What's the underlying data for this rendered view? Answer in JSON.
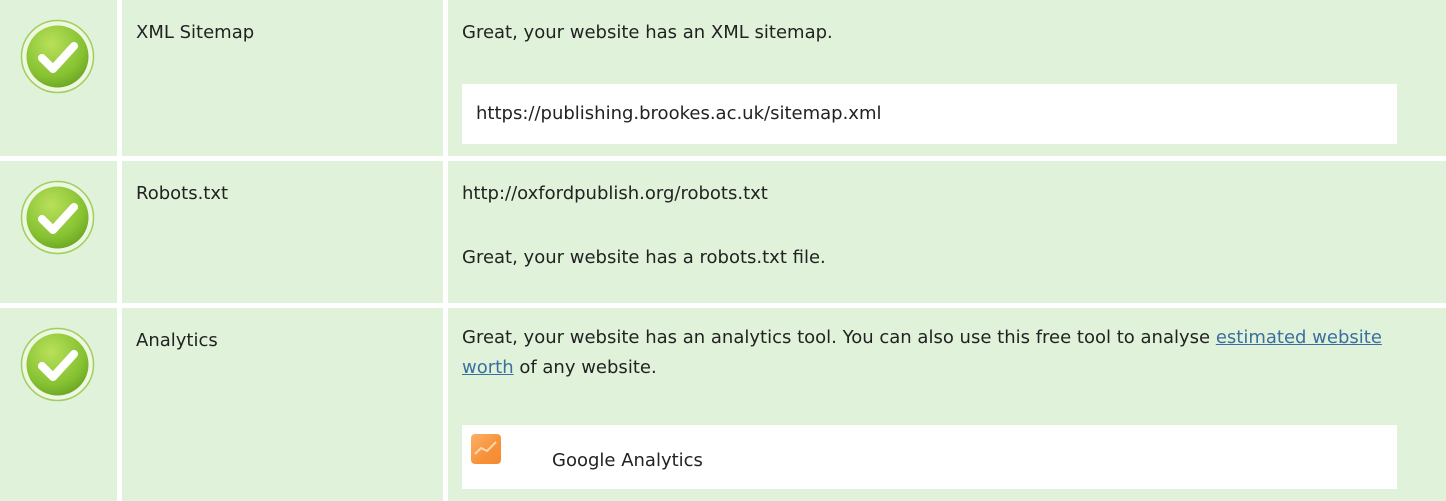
{
  "rows": [
    {
      "label": "XML Sitemap",
      "status": "pass",
      "message": "Great, your website has an XML sitemap.",
      "box": "https://publishing.brookes.ac.uk/sitemap.xml"
    },
    {
      "label": "Robots.txt",
      "status": "pass",
      "url": "http://oxfordpublish.org/robots.txt",
      "message": "Great, your website has a robots.txt file."
    },
    {
      "label": "Analytics",
      "status": "pass",
      "message_before": "Great, your website has an analytics tool. You can also use this free tool to analyse ",
      "link_text": "estimated website worth",
      "message_after": " of any website.",
      "tool": {
        "name": "Google Analytics",
        "icon": "google-analytics-icon"
      }
    }
  ],
  "colors": {
    "row_background": "#e0f2da",
    "check_green": "#8cc63f",
    "link": "#3b6fa0",
    "tool_icon": "#f7923a"
  }
}
